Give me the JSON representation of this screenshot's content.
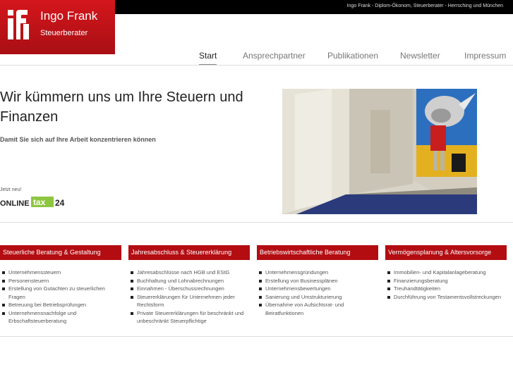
{
  "header": {
    "topbar_text": "Ingo Frank - Diplom-Ökonom, Steuerberater - Herrsching und München",
    "logo_name": "Ingo Frank",
    "logo_subtitle": "Steuerberater"
  },
  "nav": {
    "items": [
      {
        "label": "Start",
        "active": true
      },
      {
        "label": "Ansprechpartner",
        "active": false
      },
      {
        "label": "Publikationen",
        "active": false
      },
      {
        "label": "Newsletter",
        "active": false
      },
      {
        "label": "Impressum",
        "active": false
      }
    ]
  },
  "hero": {
    "headline": "Wir kümmern uns um Ihre Steuern und Finanzen",
    "subline": "Damit Sie sich auf Ihre Arbeit konzentrieren können",
    "new_label": "Jetzt neu!",
    "online_logo": {
      "word1": "ONLINE",
      "word2": "tax",
      "word3": "24"
    }
  },
  "services": [
    {
      "title": "Steuerliche Beratung & Gestaltung",
      "items": [
        "Unternehmenssteuern",
        "Personensteuern",
        "Erstellung von Gutachten zu steuerlichen Fragen",
        "Betreuung bei Betriebsprüfungen",
        "Unternehmensnachfolge und Erbschaftsteuerberatung"
      ]
    },
    {
      "title": "Jahresabschluss & Steuererklärung",
      "items": [
        "Jahresabschlüsse nach HGB und EStG",
        "Buchhaltung und Lohnabrechnungen",
        "Einnahmen - Überschussrechnungen",
        "Steuererklärungen für Unternehmen jeder Rechtsform",
        "Private Steuererklärungen für beschränkt und unbeschränkt Steuerpflichtige"
      ]
    },
    {
      "title": "Betriebswirtschaftliche Beratung",
      "items": [
        "Unternehmensgründungen",
        "Erstellung von Businessplänen",
        "Unternehmensbewertungen",
        "Sanierung und Umstrukturierung",
        "Übernahme von Aufsichtsrat- und Beiratfunktionen"
      ]
    },
    {
      "title": "Vermögensplanung & Altersvorsorge",
      "items": [
        "Immobilien- und Kapitalanlageberatung",
        "Finanzierungsberatung",
        "Treuhandtätigkeiten",
        "Durchführung von Testamentsvollstreckungen"
      ]
    }
  ],
  "colors": {
    "brand_red": "#c0141a",
    "header_black": "#000000"
  }
}
